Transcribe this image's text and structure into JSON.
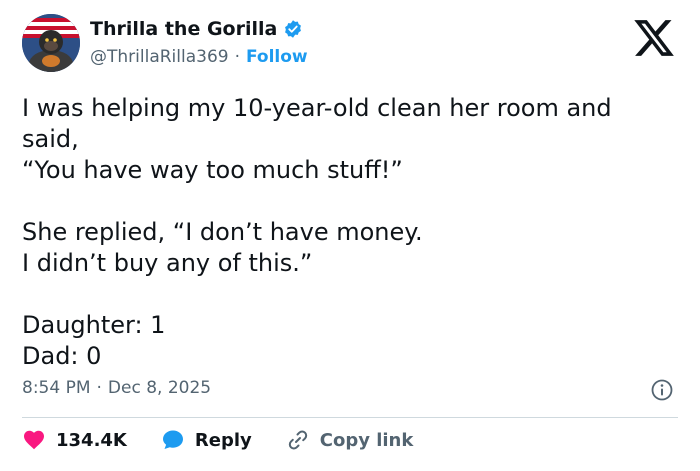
{
  "author": {
    "display_name": "Thrilla the Gorilla",
    "handle": "@ThrillaRilla369",
    "follow_label": "Follow",
    "separator": "·"
  },
  "tweet": {
    "paragraphs": [
      [
        "I was helping my 10-year-old clean her room and said,",
        "“You have way too much stuff!”"
      ],
      [
        "She replied, “I don’t have money.",
        "I didn’t buy any of this.”"
      ],
      [
        "Daughter: 1",
        "Dad: 0"
      ]
    ]
  },
  "meta": {
    "time": "8:54 PM",
    "separator": "·",
    "date": "Dec 8, 2025"
  },
  "actions": {
    "like_count": "134.4K",
    "reply_label": "Reply",
    "copy_label": "Copy link"
  },
  "colors": {
    "like": "#f91880",
    "reply": "#1d9bf0",
    "link": "#1d9bf0",
    "verified": "#1d9bf0"
  },
  "icons": [
    "verified-badge-icon",
    "x-logo-icon",
    "info-icon",
    "heart-icon",
    "reply-bubble-icon",
    "link-icon"
  ]
}
